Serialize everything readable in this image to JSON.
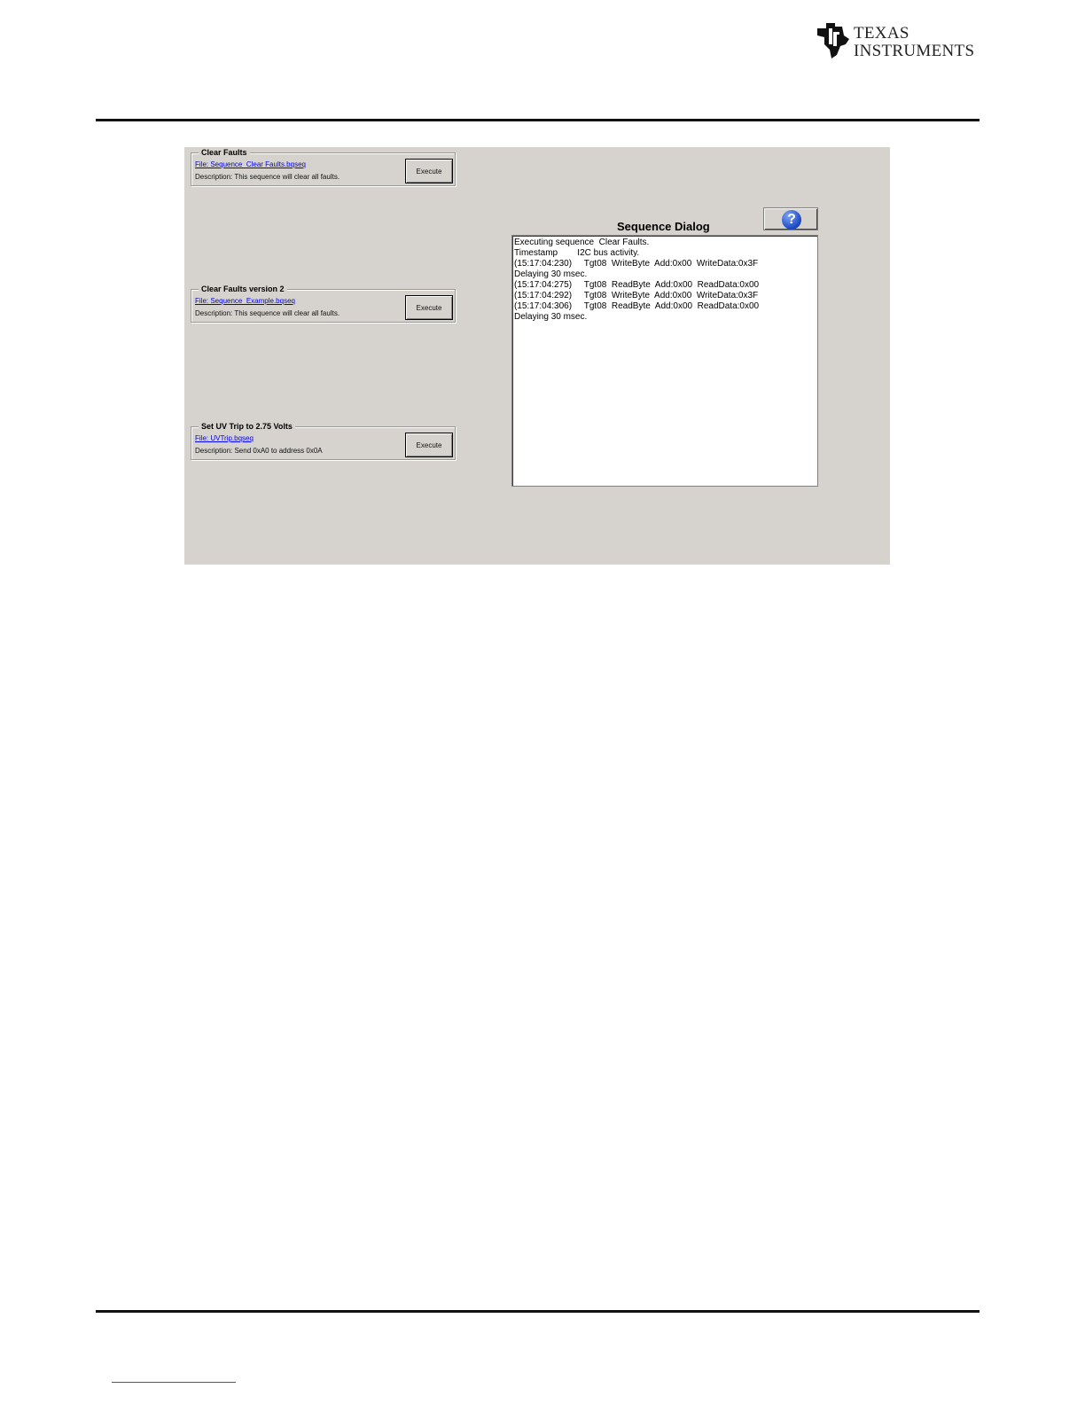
{
  "header": {
    "logo_text_line1": "Texas",
    "logo_text_line2": "Instruments"
  },
  "groups": [
    {
      "title": "Clear Faults",
      "file": "File: Sequence_Clear Faults.bqseq",
      "description": "Description:  This sequence will clear all faults.",
      "button": "Execute"
    },
    {
      "title": "Clear Faults version 2",
      "file": "File: Sequence_Example.bqseq",
      "description": "Description:  This sequence will clear all faults.",
      "button": "Execute"
    },
    {
      "title": "Set UV Trip to 2.75 Volts",
      "file": "File: UVTrip.bqseq",
      "description": "Description:  Send 0xA0 to address 0x0A",
      "button": "Execute"
    }
  ],
  "dialog": {
    "title": "Sequence Dialog",
    "help_icon": "question-icon",
    "log_lines": [
      "Executing sequence  Clear Faults.",
      "Timestamp        I2C bus activity.",
      "(15:17:04:230)     Tgt08  WriteByte  Add:0x00  WriteData:0x3F",
      "Delaying 30 msec.",
      "(15:17:04:275)     Tgt08  ReadByte  Add:0x00  ReadData:0x00",
      "(15:17:04:292)     Tgt08  WriteByte  Add:0x00  WriteData:0x3F",
      "(15:17:04:306)     Tgt08  ReadByte  Add:0x00  ReadData:0x00",
      "Delaying 30 msec."
    ]
  }
}
